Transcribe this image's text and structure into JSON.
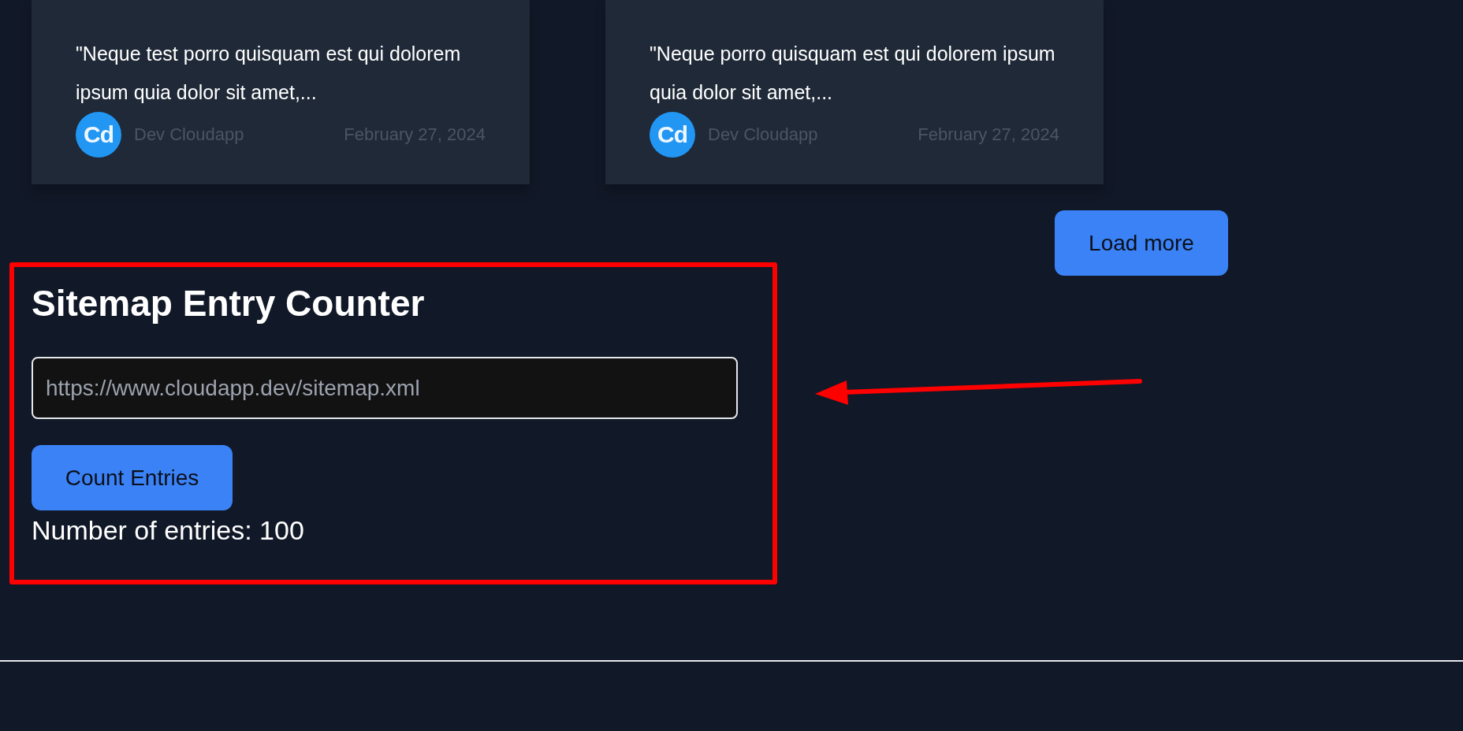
{
  "posts": [
    {
      "excerpt": "\"Neque test porro quisquam est qui dolorem ipsum quia dolor sit amet,...",
      "author": "Dev Cloudapp",
      "avatar": "Cd",
      "date": "February 27, 2024"
    },
    {
      "excerpt": "\"Neque porro quisquam est qui dolorem ipsum quia dolor sit amet,...",
      "author": "Dev Cloudapp",
      "avatar": "Cd",
      "date": "February 27, 2024"
    }
  ],
  "load_more": "Load more",
  "counter": {
    "title": "Sitemap Entry Counter",
    "placeholder": "https://www.cloudapp.dev/sitemap.xml",
    "button": "Count Entries",
    "result": "Number of entries: 100"
  }
}
